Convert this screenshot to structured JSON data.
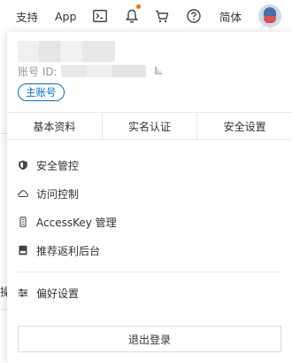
{
  "topbar": {
    "support_label": "支持",
    "app_label": "App",
    "console_icon": "terminal-icon",
    "bell_icon": "bell-icon",
    "cart_icon": "cart-icon",
    "help_icon": "help-icon",
    "language_label": "简体",
    "notification_dot_color": "#ff6a00"
  },
  "background_fragment": {
    "text": "操"
  },
  "account": {
    "id_label": "账号 ID:",
    "badge_label": "主账号",
    "accent_color": "#0070cc"
  },
  "tabs": [
    {
      "label": "基本资料"
    },
    {
      "label": "实名认证"
    },
    {
      "label": "安全设置"
    }
  ],
  "menu": [
    {
      "label": "安全管控",
      "icon": "shield-icon"
    },
    {
      "label": "访问控制",
      "icon": "cloud-icon"
    },
    {
      "label": "AccessKey 管理",
      "icon": "key-icon"
    },
    {
      "label": "推荐返利后台",
      "icon": "card-icon"
    }
  ],
  "menu_secondary": [
    {
      "label": "偏好设置",
      "icon": "sliders-icon"
    }
  ],
  "logout_label": "退出登录"
}
